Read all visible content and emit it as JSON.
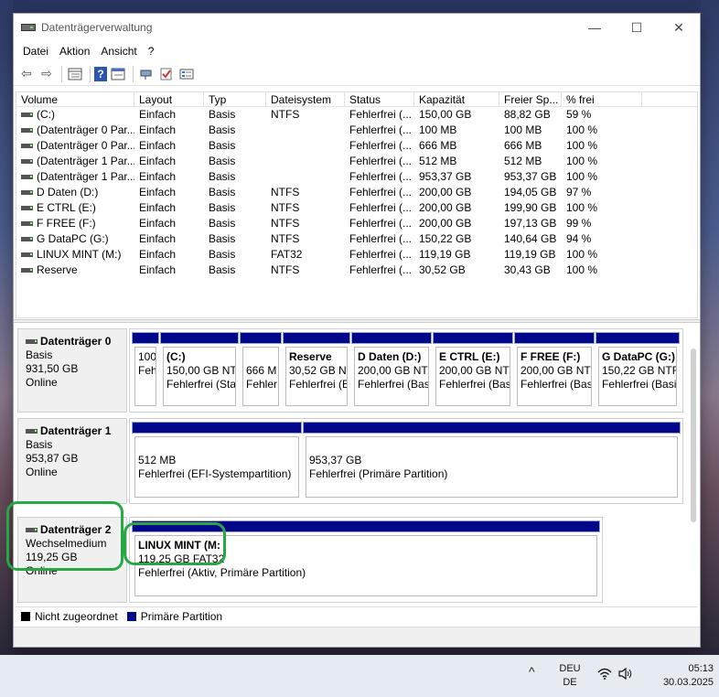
{
  "window": {
    "title": "Datenträgerverwaltung",
    "min": "—",
    "max": "☐",
    "close": "✕"
  },
  "menu": [
    "Datei",
    "Aktion",
    "Ansicht",
    "?"
  ],
  "toolbar": {
    "back": "⇦",
    "forward": "⇨",
    "help": "?",
    "check": "✓"
  },
  "volumes": {
    "headers": [
      "Volume",
      "Layout",
      "Typ",
      "Dateisystem",
      "Status",
      "Kapazität",
      "Freier Sp...",
      "% frei"
    ],
    "rows": [
      [
        "(C:)",
        "Einfach",
        "Basis",
        "NTFS",
        "Fehlerfrei (...",
        "150,00 GB",
        "88,82 GB",
        "59 %"
      ],
      [
        "(Datenträger 0 Par...",
        "Einfach",
        "Basis",
        "",
        "Fehlerfrei (...",
        "100 MB",
        "100 MB",
        "100 %"
      ],
      [
        "(Datenträger 0 Par...",
        "Einfach",
        "Basis",
        "",
        "Fehlerfrei (...",
        "666 MB",
        "666 MB",
        "100 %"
      ],
      [
        "(Datenträger 1 Par...",
        "Einfach",
        "Basis",
        "",
        "Fehlerfrei (...",
        "512 MB",
        "512 MB",
        "100 %"
      ],
      [
        "(Datenträger 1 Par...",
        "Einfach",
        "Basis",
        "",
        "Fehlerfrei (...",
        "953,37 GB",
        "953,37 GB",
        "100 %"
      ],
      [
        "D Daten (D:)",
        "Einfach",
        "Basis",
        "NTFS",
        "Fehlerfrei (...",
        "200,00 GB",
        "194,05 GB",
        "97 %"
      ],
      [
        "E CTRL (E:)",
        "Einfach",
        "Basis",
        "NTFS",
        "Fehlerfrei (...",
        "200,00 GB",
        "199,90 GB",
        "100 %"
      ],
      [
        "F FREE (F:)",
        "Einfach",
        "Basis",
        "NTFS",
        "Fehlerfrei (...",
        "200,00 GB",
        "197,13 GB",
        "99 %"
      ],
      [
        "G DataPC (G:)",
        "Einfach",
        "Basis",
        "NTFS",
        "Fehlerfrei (...",
        "150,22 GB",
        "140,64 GB",
        "94 %"
      ],
      [
        "LINUX MINT (M:)",
        "Einfach",
        "Basis",
        "FAT32",
        "Fehlerfrei (...",
        "119,19 GB",
        "119,19 GB",
        "100 %"
      ],
      [
        "Reserve",
        "Einfach",
        "Basis",
        "NTFS",
        "Fehlerfrei (...",
        "30,52 GB",
        "30,43 GB",
        "100 %"
      ]
    ]
  },
  "disks": [
    {
      "name": "Datenträger 0",
      "type": "Basis",
      "size": "931,50 GB",
      "status": "Online",
      "partitions": [
        {
          "title": "",
          "line1": "100",
          "line2": "Feh"
        },
        {
          "title": "(C:)",
          "line1": "150,00 GB NT",
          "line2": "Fehlerfrei (Sta"
        },
        {
          "title": "",
          "line1": "666 M",
          "line2": "Fehler"
        },
        {
          "title": "Reserve",
          "line1": "30,52 GB N",
          "line2": "Fehlerfrei (E"
        },
        {
          "title": "D Daten (D:)",
          "line1": "200,00 GB NTF",
          "line2": "Fehlerfrei (Basi"
        },
        {
          "title": "E CTRL (E:)",
          "line1": "200,00 GB NTF",
          "line2": "Fehlerfrei (Bas"
        },
        {
          "title": "F FREE (F:)",
          "line1": "200,00 GB NTF",
          "line2": "Fehlerfrei (Bas"
        },
        {
          "title": "G DataPC (G:)",
          "line1": "150,22 GB NTFS",
          "line2": "Fehlerfrei (Basi"
        }
      ]
    },
    {
      "name": "Datenträger 1",
      "type": "Basis",
      "size": "953,87 GB",
      "status": "Online",
      "partitions": [
        {
          "title": "",
          "line1": "512 MB",
          "line2": "Fehlerfrei (EFI-Systempartition)"
        },
        {
          "title": "",
          "line1": "953,37 GB",
          "line2": "Fehlerfrei (Primäre Partition)"
        }
      ]
    },
    {
      "name": "Datenträger 2",
      "type": "Wechselmedium",
      "size": "119,25 GB",
      "status": "Online",
      "partitions": [
        {
          "title": "LINUX MINT  (M:",
          "line1": "119,25 GB FAT32",
          "line2": "Fehlerfrei (Aktiv, Primäre Partition)"
        }
      ]
    }
  ],
  "legend": {
    "unallocated": "Nicht zugeordnet",
    "primary": "Primäre Partition"
  },
  "colors": {
    "primary_partition": "#00078a",
    "unallocated": "#000000",
    "highlight": "#27a844"
  },
  "taskbar": {
    "chevron": "^",
    "lang1": "DEU",
    "lang2": "DE",
    "time": "05:13",
    "date": "30.03.2025",
    "wifi": "((•",
    "volume": "🔊"
  }
}
